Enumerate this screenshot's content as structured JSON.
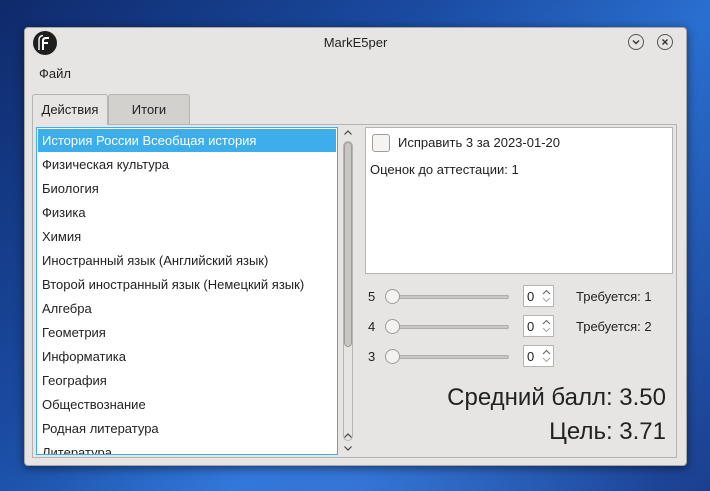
{
  "window": {
    "title": "MarkE5per"
  },
  "menu": {
    "file": "Файл"
  },
  "tabs": [
    {
      "label": "Действия"
    },
    {
      "label": "Итоги"
    }
  ],
  "subjects": [
    "История России Всеобщая история",
    "Физическая культура",
    "Биология",
    "Физика",
    "Химия",
    "Иностранный язык (Английский язык)",
    "Второй иностранный язык (Немецкий язык)",
    "Алгебра",
    "Геометрия",
    "Информатика",
    "География",
    "Обществознание",
    "Родная литература",
    "Литература"
  ],
  "selected_subject_index": 0,
  "info": {
    "fix_checkbox_label": "Исправить 3 за 2023-01-20",
    "fix_checkbox_checked": false,
    "marks_until_attestation": "Оценок до аттестации: 1"
  },
  "grade_rows": [
    {
      "grade": "5",
      "value": "0",
      "required": "Требуется: 1"
    },
    {
      "grade": "4",
      "value": "0",
      "required": "Требуется: 2"
    },
    {
      "grade": "3",
      "value": "0",
      "required": ""
    }
  ],
  "summary": {
    "average": "Средний балл: 3.50",
    "goal": "Цель: 3.71"
  },
  "colors": {
    "selection": "#3daee9",
    "window_bg": "#e6e5e3"
  }
}
